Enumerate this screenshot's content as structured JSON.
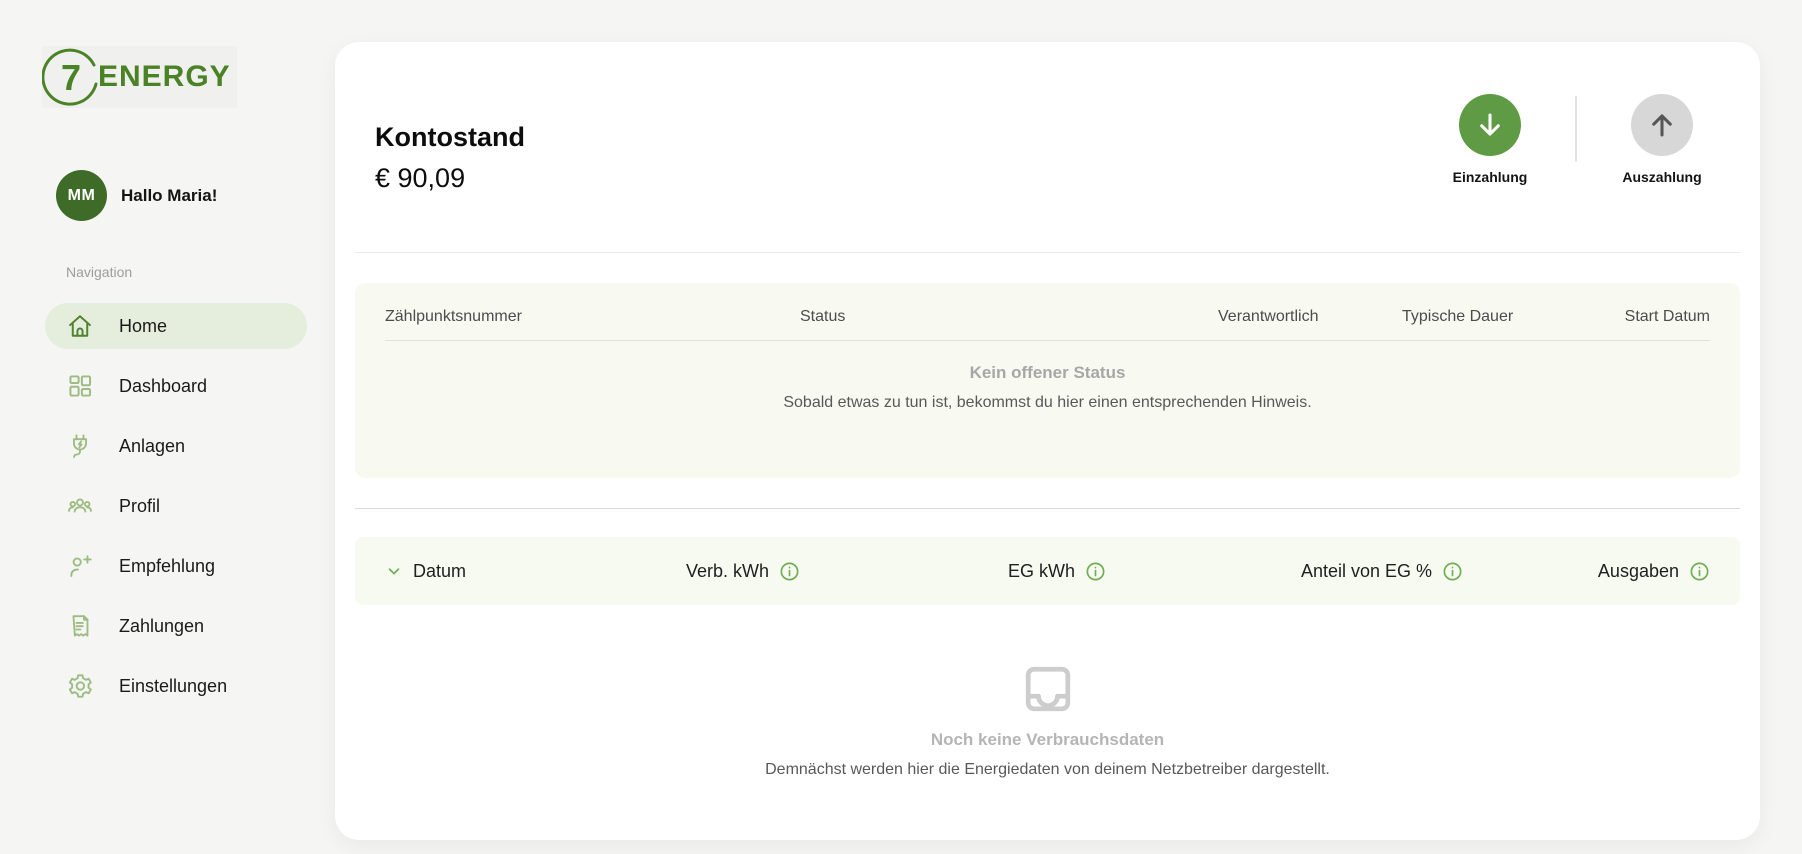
{
  "brand": {
    "logo_number": "7",
    "logo_text": "ENERGY"
  },
  "user": {
    "initials": "MM",
    "greeting": "Hallo Maria!"
  },
  "sidebar": {
    "section_label": "Navigation",
    "items": [
      {
        "label": "Home",
        "icon": "home-icon",
        "active": true
      },
      {
        "label": "Dashboard",
        "icon": "dashboard-icon",
        "active": false
      },
      {
        "label": "Anlagen",
        "icon": "plug-icon",
        "active": false
      },
      {
        "label": "Profil",
        "icon": "people-icon",
        "active": false
      },
      {
        "label": "Empfehlung",
        "icon": "person-add-icon",
        "active": false
      },
      {
        "label": "Zahlungen",
        "icon": "receipt-icon",
        "active": false
      },
      {
        "label": "Einstellungen",
        "icon": "gear-icon",
        "active": false
      }
    ]
  },
  "account": {
    "title": "Kontostand",
    "balance": "€ 90,09",
    "deposit_label": "Einzahlung",
    "withdraw_label": "Auszahlung"
  },
  "status_table": {
    "columns": [
      "Zählpunktsnummer",
      "Status",
      "Verantwortlich",
      "Typische Dauer",
      "Start Datum"
    ],
    "empty_title": "Kein offener Status",
    "empty_subtitle": "Sobald etwas zu tun ist, bekommst du hier einen entsprechenden Hinweis."
  },
  "consumption_table": {
    "columns": [
      "Datum",
      "Verb. kWh",
      "EG kWh",
      "Anteil von EG %",
      "Ausgaben"
    ],
    "empty_title": "Noch keine Verbrauchsdaten",
    "empty_subtitle": "Demnächst werden hier die Energiedaten von deinem Netzbetreiber dargestellt."
  },
  "colors": {
    "primary_green": "#5f9a44",
    "dark_green": "#3e6b27",
    "logo_green": "#4a8226",
    "nav_icon_green": "#9dbc82",
    "active_pill": "#e5eedd",
    "card_bg": "#f8faf2",
    "page_bg": "#f5f5f3"
  }
}
